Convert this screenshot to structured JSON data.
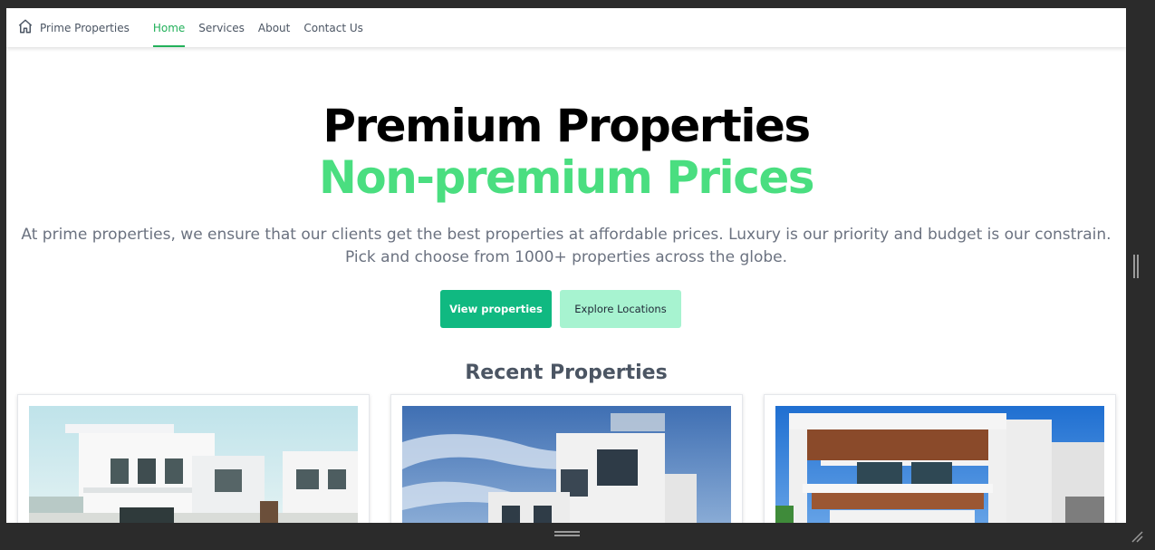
{
  "navbar": {
    "brand_icon": "home-icon",
    "brand": "Prime Properties",
    "links": [
      {
        "label": "Home",
        "active": true
      },
      {
        "label": "Services",
        "active": false
      },
      {
        "label": "About",
        "active": false
      },
      {
        "label": "Contact Us",
        "active": false
      }
    ]
  },
  "hero": {
    "title_line1": "Premium Properties",
    "title_line2": "Non-premium Prices",
    "description": "At prime properties, we ensure that our clients get the best properties at affordable prices. Luxury is our priority and budget is our constrain. Pick and choose from 1000+ properties across the globe.",
    "primary_button": "View properties",
    "secondary_button": "Explore Locations"
  },
  "recent": {
    "title": "Recent Properties",
    "cards": [
      {
        "image": "modern-white-villa-photo"
      },
      {
        "image": "white-apartment-building-photo"
      },
      {
        "image": "modern-house-wood-ceiling-photo"
      }
    ]
  },
  "colors": {
    "accent": "#22b05a",
    "title_green": "#4ade80",
    "primary_button": "#10b981",
    "secondary_button": "#a7f3d0",
    "text_muted": "#6b7280"
  }
}
